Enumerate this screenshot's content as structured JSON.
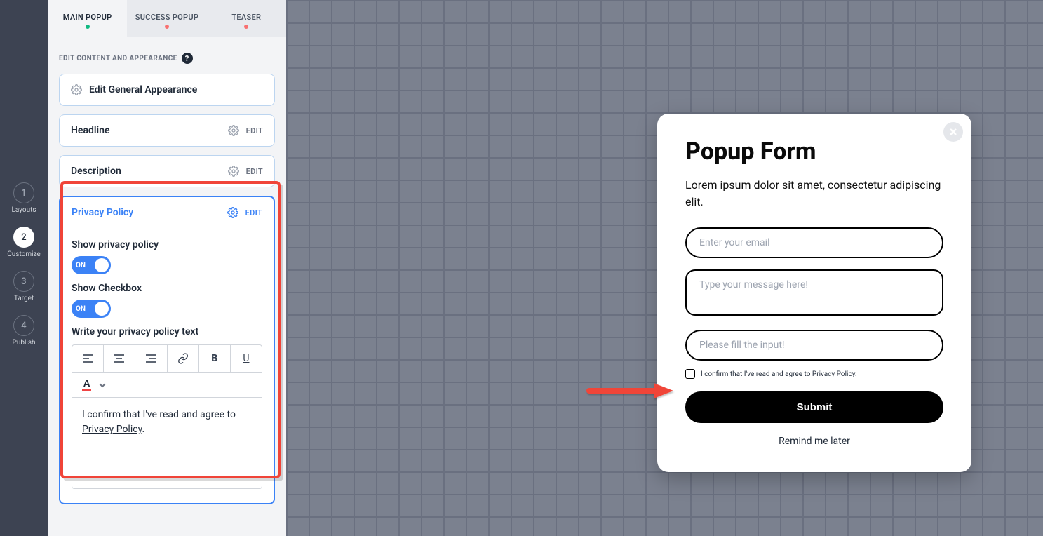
{
  "nav": [
    {
      "num": "1",
      "label": "Layouts",
      "active": false
    },
    {
      "num": "2",
      "label": "Customize",
      "active": true
    },
    {
      "num": "3",
      "label": "Target",
      "active": false
    },
    {
      "num": "4",
      "label": "Publish",
      "active": false
    }
  ],
  "tabs": [
    {
      "label": "MAIN POPUP",
      "dot": "green",
      "active": true
    },
    {
      "label": "SUCCESS POPUP",
      "dot": "red",
      "active": false
    },
    {
      "label": "TEASER",
      "dot": "red",
      "active": false
    }
  ],
  "panel": {
    "section_label": "EDIT CONTENT AND APPEARANCE",
    "general": "Edit General Appearance",
    "edit_label": "EDIT",
    "headline": "Headline",
    "description": "Description",
    "privacy_title": "Privacy Policy",
    "show_privacy": "Show privacy policy",
    "show_checkbox": "Show Checkbox",
    "toggle_on": "ON",
    "write_label": "Write your privacy policy text",
    "editor_prefix": "I confirm that I've read and agree to ",
    "editor_link": "Privacy Policy",
    "editor_suffix": "."
  },
  "popup": {
    "title": "Popup Form",
    "description": "Lorem ipsum dolor sit amet, consectetur adipiscing elit.",
    "email_placeholder": "Enter your email",
    "message_placeholder": "Type your message here!",
    "input3_placeholder": "Please fill the input!",
    "privacy_prefix": "I confirm that I've read and agree to ",
    "privacy_link": "Privacy Policy",
    "privacy_suffix": ".",
    "submit": "Submit",
    "remind": "Remind me later"
  }
}
